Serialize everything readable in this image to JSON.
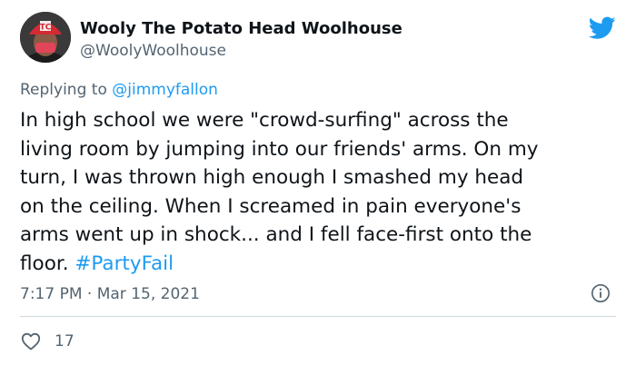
{
  "author": {
    "display_name": "Wooly The Potato Head Woolhouse",
    "handle": "@WoolyWoolhouse",
    "avatar_icon": "avatar-red-twins-cap"
  },
  "reply": {
    "prefix": "Replying to ",
    "mention": "@jimmyfallon"
  },
  "body": {
    "lines": [
      "In high school we were \"crowd-surfing\" across the",
      "living room by jumping into our friends' arms. On my",
      "turn, I was thrown high enough I smashed my head",
      "on the ceiling. When I screamed in pain everyone's",
      "arms went up in shock... and I fell face-first onto the"
    ],
    "last_line_text": "floor. ",
    "hashtag": "#PartyFail"
  },
  "meta": {
    "timestamp": "7:17 PM · Mar 15, 2021"
  },
  "actions": {
    "like_count": "17"
  },
  "icons": {
    "brand": "twitter-bird-icon",
    "info": "info-icon",
    "like": "heart-icon"
  },
  "colors": {
    "twitter_blue": "#1d9bf0",
    "text": "#0f1419",
    "secondary": "#536471",
    "divider": "#cfd9de"
  }
}
